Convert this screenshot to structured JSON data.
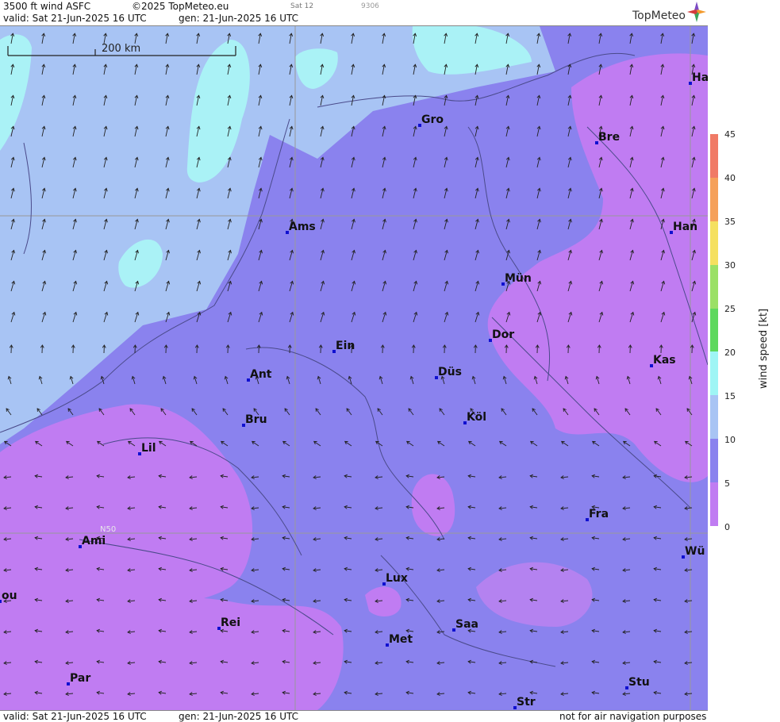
{
  "header": {
    "product": "3500 ft wind ASFC",
    "copyright": "©2025 TopMeteo.eu",
    "small_code1": "Sat 12",
    "small_code2": "9306",
    "valid": "valid:  Sat  21-Jun-2025  16 UTC",
    "gen": "gen:  21-Jun-2025  16 UTC",
    "logo": "TopMeteo"
  },
  "footer": {
    "valid": "valid:  Sat  21-Jun-2025  16 UTC",
    "gen": "gen:  21-Jun-2025 16 UTC",
    "disclaimer": "not for air navigation purposes"
  },
  "map": {
    "scale_label": "200 km",
    "lat_label": "N50",
    "cities": [
      "Ha",
      "Gro",
      "Bre",
      "Ams",
      "Han",
      "Mün",
      "Ein",
      "Dor",
      "Ant",
      "Düs",
      "Kas",
      "Bru",
      "Köl",
      "Lil",
      "Fra",
      "Ami",
      "Wü",
      "Lux",
      "ou",
      "Rei",
      "Saa",
      "Met",
      "Stu",
      "Par",
      "Str"
    ]
  },
  "legend": {
    "title": "wind  speed  [kt]",
    "ticks": [
      "45",
      "40",
      "35",
      "30",
      "25",
      "20",
      "15",
      "10",
      "5",
      "0"
    ],
    "colors": [
      "#f07a66",
      "#f5a05a",
      "#f5e060",
      "#9be066",
      "#5ed85e",
      "#9ff5f5",
      "#a8c4f4",
      "#8a82ee",
      "#c07cf2"
    ]
  }
}
